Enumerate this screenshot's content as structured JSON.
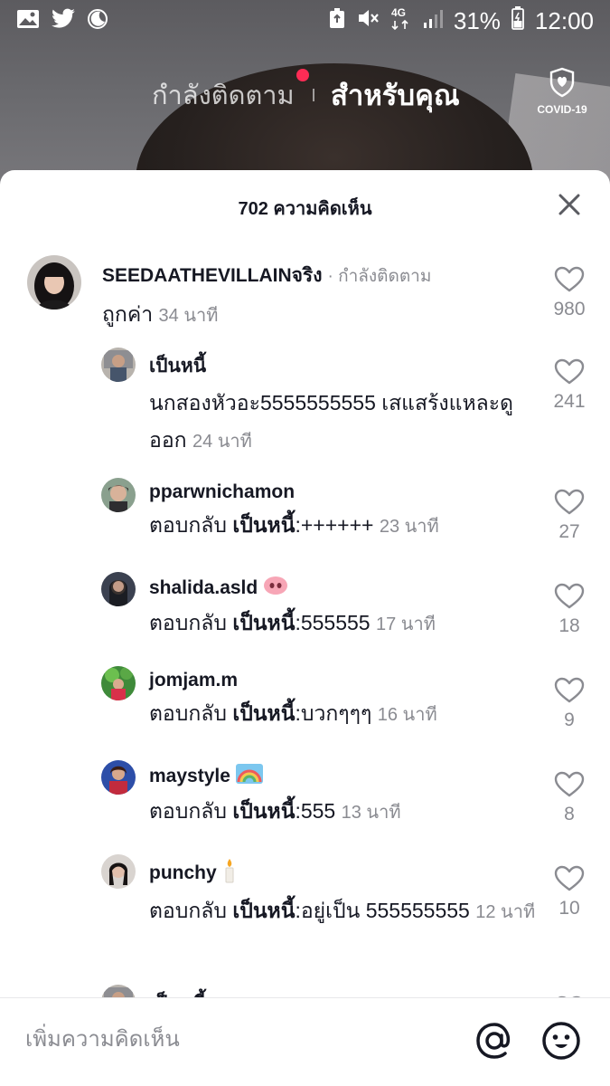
{
  "status_bar": {
    "battery_percent": "31%",
    "time": "12:00",
    "network": "4G",
    "icons": [
      "image-icon",
      "twitter-icon",
      "moon-icon",
      "recycle-icon",
      "mute-icon",
      "network-4g-icon",
      "signal-icon",
      "battery-icon"
    ]
  },
  "top_nav": {
    "following_label": "กำลังติดตาม",
    "for_you_label": "สำหรับคุณ",
    "covid_label": "COVID-19"
  },
  "comments_sheet": {
    "title": "702 ความคิดเห็น",
    "input_placeholder": "เพิ่มความคิดเห็น"
  },
  "comments": [
    {
      "username": "SEEDAATHEVILLAINจริง",
      "following_label": "· กำลังติดตาม",
      "text": "ถูกค่า",
      "time": "34 นาที",
      "likes": "980"
    }
  ],
  "replies": [
    {
      "username": "เป็นหนี้",
      "prefix": "",
      "reply_to": "",
      "text": "นกสองหัวอะ5555555555 เสแสร้งแหละดูออก",
      "time": "24 นาที",
      "likes": "241"
    },
    {
      "username": "pparwnichamon",
      "prefix": "ตอบกลับ",
      "reply_to": "เป็นหนี้",
      "text": ":++++++",
      "time": "23 นาที",
      "likes": "27"
    },
    {
      "username": "shalida.asld",
      "prefix": "ตอบกลับ",
      "reply_to": "เป็นหนี้",
      "text": ":555555",
      "time": "17 นาที",
      "likes": "18"
    },
    {
      "username": "jomjam.m",
      "prefix": "ตอบกลับ",
      "reply_to": "เป็นหนี้",
      "text": ":บวกๆๆๆ",
      "time": "16 นาที",
      "likes": "9"
    },
    {
      "username": "maystyle",
      "prefix": "ตอบกลับ",
      "reply_to": "เป็นหนี้",
      "text": ":555",
      "time": "13 นาที",
      "likes": "8"
    },
    {
      "username": "punchy",
      "prefix": "ตอบกลับ",
      "reply_to": "เป็นหนี้",
      "text": ":อยู่เป็น 555555555",
      "time": "12 นาที",
      "likes": "10"
    },
    {
      "username": "เป็นหนี้",
      "prefix": "",
      "reply_to": "",
      "text": "",
      "time": "",
      "likes": ""
    }
  ],
  "colors": {
    "accent_red": "#fe2c55",
    "text_primary": "#161823",
    "text_secondary": "#8a8b91"
  }
}
